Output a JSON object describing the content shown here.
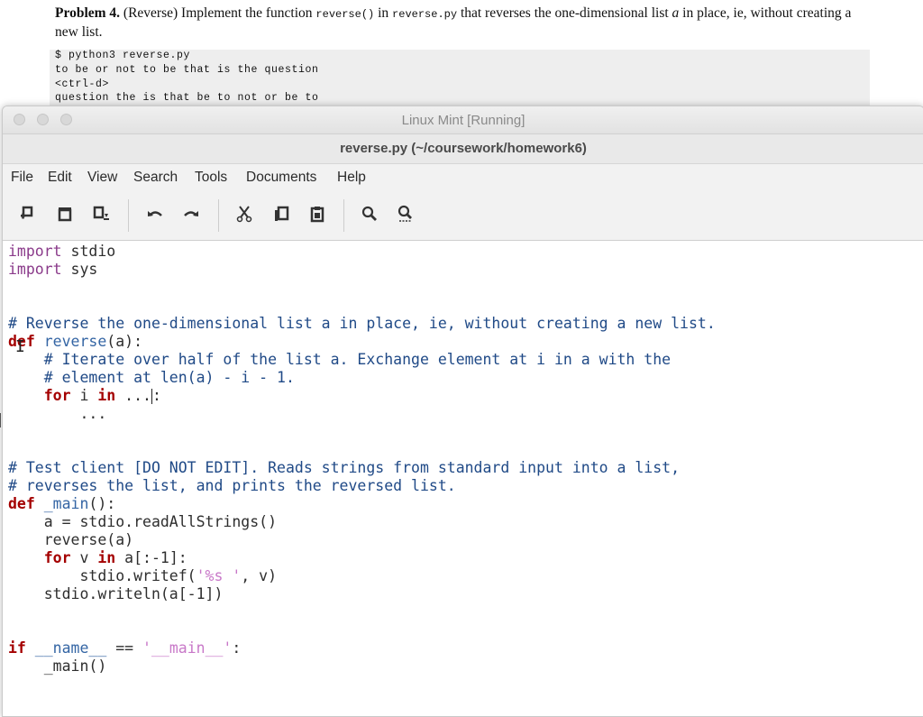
{
  "document": {
    "problem_label": "Problem 4.",
    "problem_name": "(Reverse)",
    "text_a": " Implement the function ",
    "fn_code": "reverse()",
    "text_b": " in ",
    "file_code": "reverse.py",
    "text_c": " that reverses the one-dimensional list ",
    "var_a": "a",
    "text_d": " in place, ie, without creating a new list.",
    "terminal": [
      "$ python3 reverse.py",
      "to be or not to be that is the question",
      "<ctrl-d>",
      "question the is that be to not or be to"
    ]
  },
  "vm_window": {
    "title": "Linux Mint [Running]"
  },
  "gedit": {
    "title": "reverse.py (~/coursework/homework6)",
    "menu": [
      "File",
      "Edit",
      "View",
      "Search",
      "Tools",
      "Documents",
      "Help"
    ],
    "toolbar_icons": [
      "new-document-icon",
      "open-document-icon",
      "save-document-icon",
      "undo-icon",
      "redo-icon",
      "cut-icon",
      "copy-icon",
      "paste-icon",
      "search-icon",
      "search-replace-icon"
    ]
  },
  "code": {
    "l1_kw": "import",
    "l1_rest": " stdio",
    "l2_kw": "import",
    "l2_rest": " sys",
    "l5": "# Reverse the one-dimensional list a in place, ie, without creating a new list.",
    "l6_kw": "def",
    "l6_fn": "reverse",
    "l6_rest": "(a):",
    "l7": "    # Iterate over half of the list a. Exchange element at i in a with the",
    "l8": "    # element at len(a) - i - 1.",
    "l9_indent": "    ",
    "l9_kw1": "for",
    "l9_mid": " i ",
    "l9_kw2": "in",
    "l9_rest_a": " ...",
    "l9_rest_b": ":",
    "l10": "        ...",
    "l13": "# Test client [DO NOT EDIT]. Reads strings from standard input into a list,",
    "l14": "# reverses the list, and prints the reversed list.",
    "l15_kw": "def",
    "l15_fn": "_main",
    "l15_rest": "():",
    "l16": "    a = stdio.readAllStrings()",
    "l17": "    reverse(a)",
    "l18_indent": "    ",
    "l18_kw1": "for",
    "l18_mid": " v ",
    "l18_kw2": "in",
    "l18_rest": " a[:-1]:",
    "l19_a": "        stdio.writef(",
    "l19_str": "'%s '",
    "l19_b": ", v)",
    "l20": "    stdio.writeln(a[-1])",
    "l23_kw": "if",
    "l23_name": " __name__",
    "l23_op": " == ",
    "l23_str": "'__main__'",
    "l23_end": ":",
    "l24": "    _main()"
  }
}
